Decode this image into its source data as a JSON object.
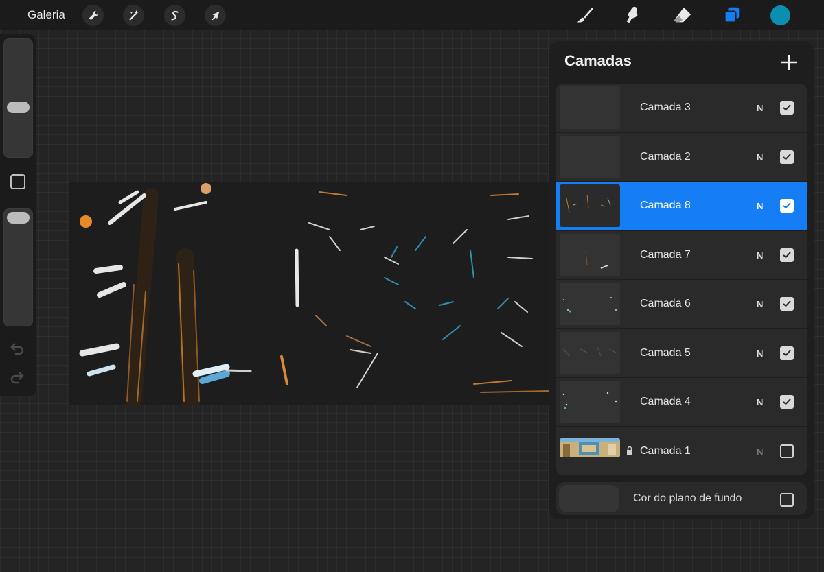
{
  "toolbar": {
    "gallery_label": "Galeria",
    "tools": [
      "wrench-icon",
      "magic-wand-icon",
      "selection-s-icon",
      "arrow-cursor-icon"
    ],
    "right_tools": [
      "brush-icon",
      "smudge-icon",
      "eraser-icon",
      "layers-icon"
    ],
    "active_color": "#0a8fb3",
    "accent_color": "#157ef5"
  },
  "layers_panel": {
    "title": "Camadas",
    "layers": [
      {
        "name": "Camada 3",
        "blend": "N",
        "visible": true,
        "active": false,
        "locked": false
      },
      {
        "name": "Camada 2",
        "blend": "N",
        "visible": true,
        "active": false,
        "locked": false
      },
      {
        "name": "Camada 8",
        "blend": "N",
        "visible": true,
        "active": true,
        "locked": false
      },
      {
        "name": "Camada 7",
        "blend": "N",
        "visible": true,
        "active": false,
        "locked": false
      },
      {
        "name": "Camada 6",
        "blend": "N",
        "visible": true,
        "active": false,
        "locked": false
      },
      {
        "name": "Camada 5",
        "blend": "N",
        "visible": true,
        "active": false,
        "locked": false
      },
      {
        "name": "Camada 4",
        "blend": "N",
        "visible": true,
        "active": false,
        "locked": false
      },
      {
        "name": "Camada 1",
        "blend": "N",
        "visible": false,
        "active": false,
        "locked": true
      }
    ],
    "background": {
      "label": "Cor do plano de fundo",
      "visible": false
    }
  }
}
